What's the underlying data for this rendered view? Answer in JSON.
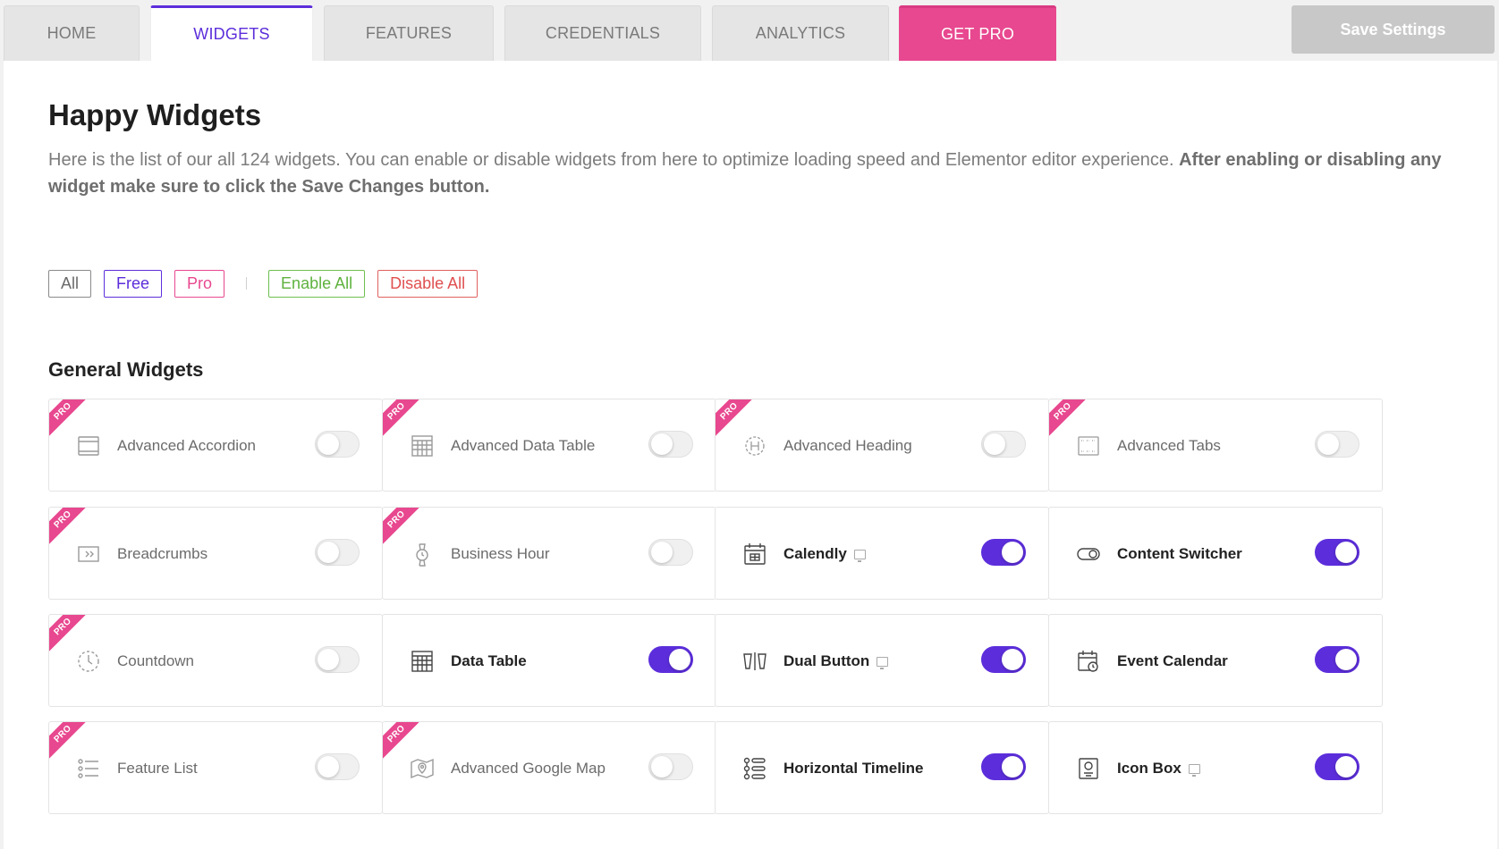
{
  "tabs": [
    {
      "label": "HOME",
      "state": "normal"
    },
    {
      "label": "WIDGETS",
      "state": "active"
    },
    {
      "label": "FEATURES",
      "state": "normal"
    },
    {
      "label": "CREDENTIALS",
      "state": "normal"
    },
    {
      "label": "ANALYTICS",
      "state": "normal"
    },
    {
      "label": "GET PRO",
      "state": "pro"
    }
  ],
  "save_button": "Save Settings",
  "page": {
    "title": "Happy Widgets",
    "description": "Here is the list of our all 124 widgets. You can enable or disable widgets from here to optimize loading speed and Elementor editor experience.",
    "description_bold": "After enabling or disabling any widget make sure to click the Save Changes button."
  },
  "filters": {
    "all": "All",
    "free": "Free",
    "pro": "Pro",
    "enable_all": "Enable All",
    "disable_all": "Disable All"
  },
  "section_title": "General Widgets",
  "pro_ribbon": "PRO",
  "colors": {
    "accent": "#5c2edb",
    "pro": "#e8488f",
    "enable": "#5fb23e",
    "disable": "#e05050"
  },
  "widgets": [
    {
      "label": "Advanced Accordion",
      "icon": "accordion-icon",
      "pro": true,
      "enabled": false,
      "demo": false
    },
    {
      "label": "Advanced Data Table",
      "icon": "data-table-icon",
      "pro": true,
      "enabled": false,
      "demo": false
    },
    {
      "label": "Advanced Heading",
      "icon": "heading-icon",
      "pro": true,
      "enabled": false,
      "demo": false
    },
    {
      "label": "Advanced Tabs",
      "icon": "tabs-icon",
      "pro": true,
      "enabled": false,
      "demo": false
    },
    {
      "label": "Breadcrumbs",
      "icon": "breadcrumbs-icon",
      "pro": true,
      "enabled": false,
      "demo": false
    },
    {
      "label": "Business Hour",
      "icon": "business-hour-icon",
      "pro": true,
      "enabled": false,
      "demo": false
    },
    {
      "label": "Calendly",
      "icon": "calendly-icon",
      "pro": false,
      "enabled": true,
      "demo": true
    },
    {
      "label": "Content Switcher",
      "icon": "content-switcher-icon",
      "pro": false,
      "enabled": true,
      "demo": false
    },
    {
      "label": "Countdown",
      "icon": "countdown-icon",
      "pro": true,
      "enabled": false,
      "demo": false
    },
    {
      "label": "Data Table",
      "icon": "data-table-icon",
      "pro": false,
      "enabled": true,
      "demo": false
    },
    {
      "label": "Dual Button",
      "icon": "dual-button-icon",
      "pro": false,
      "enabled": true,
      "demo": true
    },
    {
      "label": "Event Calendar",
      "icon": "event-calendar-icon",
      "pro": false,
      "enabled": true,
      "demo": false
    },
    {
      "label": "Feature List",
      "icon": "feature-list-icon",
      "pro": true,
      "enabled": false,
      "demo": false
    },
    {
      "label": "Advanced Google Map",
      "icon": "map-icon",
      "pro": true,
      "enabled": false,
      "demo": false
    },
    {
      "label": "Horizontal Timeline",
      "icon": "timeline-icon",
      "pro": false,
      "enabled": true,
      "demo": false
    },
    {
      "label": "Icon Box",
      "icon": "icon-box-icon",
      "pro": false,
      "enabled": true,
      "demo": true
    }
  ]
}
